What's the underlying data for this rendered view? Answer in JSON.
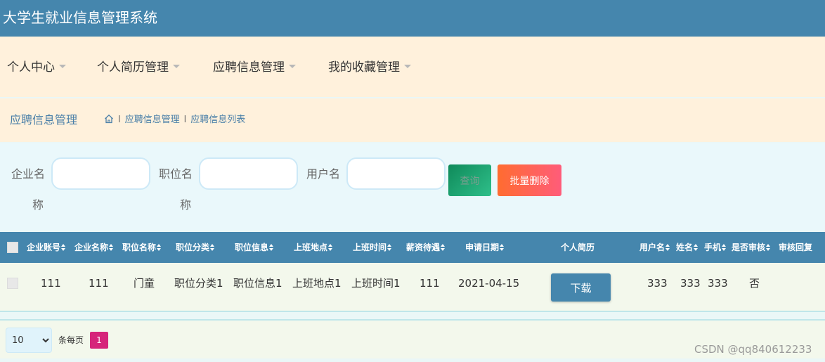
{
  "app": {
    "title": "大学生就业信息管理系统"
  },
  "nav": {
    "items": [
      {
        "label": "个人中心"
      },
      {
        "label": "个人简历管理"
      },
      {
        "label": "应聘信息管理"
      },
      {
        "label": "我的收藏管理"
      }
    ]
  },
  "breadcrumb": {
    "page_title": "应聘信息管理",
    "items": [
      "应聘信息管理",
      "应聘信息列表"
    ],
    "separator": "l"
  },
  "search": {
    "company_label_1": "企业名",
    "company_label_2": "称",
    "position_label_1": "职位名",
    "position_label_2": "称",
    "user_label": "用户名",
    "company_value": "",
    "position_value": "",
    "user_value": "",
    "query_button": "查询",
    "batch_delete_button": "批量删除"
  },
  "table": {
    "headers": [
      {
        "label": "企业账号",
        "sortable": true
      },
      {
        "label": "企业名称",
        "sortable": true
      },
      {
        "label": "职位名称",
        "sortable": true
      },
      {
        "label": "职位分类",
        "sortable": true
      },
      {
        "label": "职位信息",
        "sortable": true
      },
      {
        "label": "上班地点",
        "sortable": true
      },
      {
        "label": "上班时间",
        "sortable": true
      },
      {
        "label": "薪资待遇",
        "sortable": true
      },
      {
        "label": "申请日期",
        "sortable": true
      },
      {
        "label": "个人简历",
        "sortable": false
      },
      {
        "label": "用户名",
        "sortable": true
      },
      {
        "label": "姓名",
        "sortable": true
      },
      {
        "label": "手机",
        "sortable": true
      },
      {
        "label": "是否审核",
        "sortable": true
      },
      {
        "label": "审核回复",
        "sortable": false
      }
    ],
    "rows": [
      {
        "company_account": "111",
        "company_name": "111",
        "position_name": "门童",
        "position_category": "职位分类1",
        "position_info": "职位信息1",
        "work_location": "上班地点1",
        "work_time": "上班时间1",
        "salary": "111",
        "apply_date": "2021-04-15",
        "resume_action": "下载",
        "username": "333",
        "name": "333",
        "phone": "333",
        "reviewed": "否",
        "review_reply": ""
      }
    ]
  },
  "pagination": {
    "page_size": "10",
    "page_size_options": [
      "10"
    ],
    "per_page_label": "条每页",
    "current_page": "1"
  },
  "watermark": "CSDN @qq840612233",
  "colors": {
    "header_blue": "#4586ad",
    "nav_cream": "#fff1dc",
    "query_green": "#0f8a5a",
    "delete_red": "#ff5c5c",
    "page_pink": "#d6247a"
  }
}
